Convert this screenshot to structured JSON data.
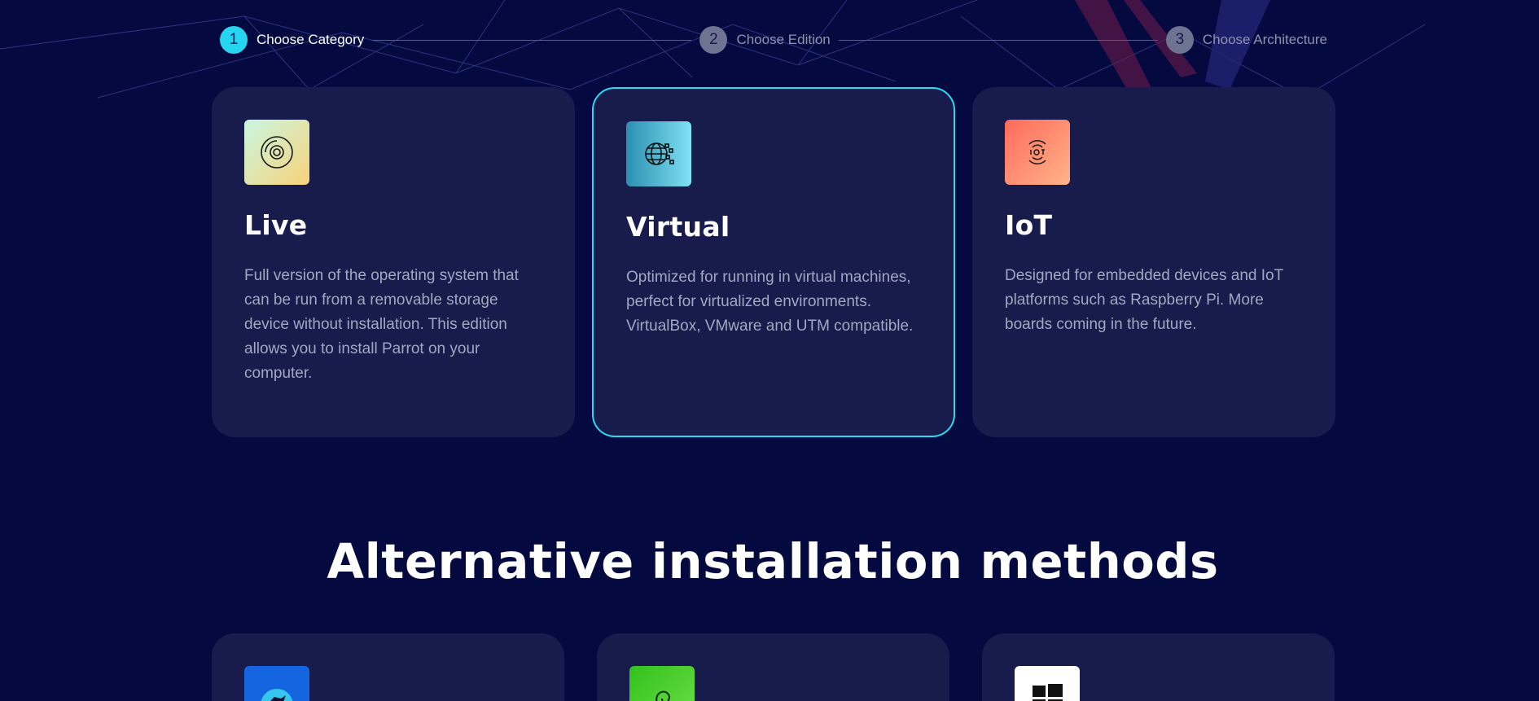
{
  "stepper": {
    "steps": [
      {
        "number": "1",
        "label": "Choose Category",
        "active": true
      },
      {
        "number": "2",
        "label": "Choose Edition",
        "active": false
      },
      {
        "number": "3",
        "label": "Choose Architecture",
        "active": false
      }
    ]
  },
  "categories": [
    {
      "icon": "disc-icon",
      "title": "Live",
      "description": "Full version of the operating system that can be run from a removable storage device without installation. This edition allows you to install Parrot on your computer.",
      "icon_gradient": [
        "#c9f7e0",
        "#f8d27a"
      ],
      "selected": false
    },
    {
      "icon": "globe-pixels-icon",
      "title": "Virtual",
      "description": "Optimized for running in virtual machines, perfect for virtualized environments. VirtualBox, VMware and UTM compatible.",
      "icon_gradient": [
        "#2b8fb0",
        "#7fe2f4"
      ],
      "selected": true
    },
    {
      "icon": "iot-icon",
      "title": "IoT",
      "description": "Designed for embedded devices and IoT platforms such as Raspberry Pi. More boards coming in the future.",
      "icon_gradient": [
        "#ff6a5a",
        "#ffb48a"
      ],
      "selected": false
    }
  ],
  "alternative": {
    "title": "Alternative installation methods",
    "items": [
      {
        "icon": "parrot-logo-icon",
        "icon_color": "#1565e0"
      },
      {
        "icon": "debian-swirl-icon",
        "icon_color": "#3fc72a"
      },
      {
        "icon": "windows-logo-icon",
        "icon_color": "#ffffff"
      }
    ]
  },
  "colors": {
    "background": "#040a3f",
    "card": "#181c4d",
    "accent": "#2fd8f2"
  }
}
